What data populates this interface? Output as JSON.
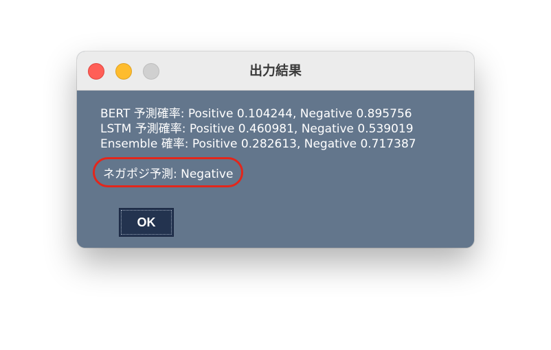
{
  "window": {
    "title": "出力結果"
  },
  "results": {
    "lines": [
      "BERT 予測確率: Positive 0.104244, Negative 0.895756",
      "LSTM 予測確率: Positive 0.460981, Negative 0.539019",
      "Ensemble 確率: Positive 0.282613, Negative 0.717387"
    ],
    "prediction": "ネガポジ予測: Negative"
  },
  "buttons": {
    "ok_label": "OK"
  },
  "colors": {
    "content_background": "#63768c",
    "titlebar_background": "#ececec",
    "highlight_border": "#e3261b",
    "ok_button_background": "#23334f",
    "close": "#ff5f57",
    "minimize": "#febc2e",
    "zoom_disabled": "#d0d0d0"
  },
  "icons": {
    "close": "close-icon",
    "minimize": "minimize-icon",
    "zoom": "zoom-icon"
  }
}
